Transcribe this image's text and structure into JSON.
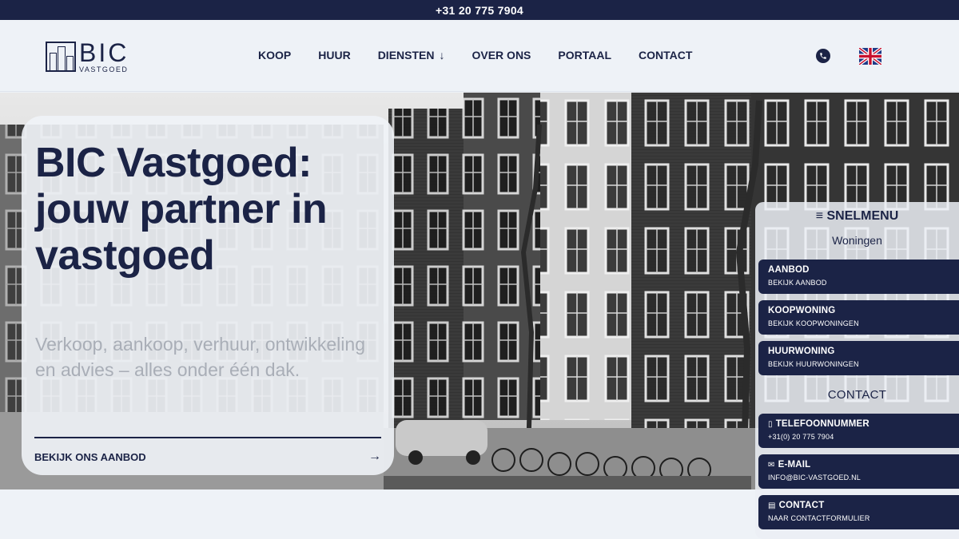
{
  "topbar": {
    "phone": "+31 20 775 7904"
  },
  "logo": {
    "main": "BIC",
    "sub": "VASTGOED"
  },
  "nav": {
    "koop": "KOOP",
    "huur": "HUUR",
    "diensten": "DIENSTEN",
    "over_ons": "OVER ONS",
    "portaal": "PORTAAL",
    "contact": "CONTACT",
    "diensten_arrow": "↓"
  },
  "hero": {
    "title": "BIC Vastgoed: jouw partner in vastgoed",
    "subtitle": "Verkoop, aankoop, verhuur, ontwikkeling en advies – alles onder één dak.",
    "cta": "BEKIJK ONS AANBOD",
    "cta_arrow": "→"
  },
  "snelmenu": {
    "title": "≡ SNELMENU",
    "woningen": "Woningen",
    "contact_heading": "CONTACT",
    "items": [
      {
        "title": "AANBOD",
        "sub": "BEKIJK AANBOD",
        "icon": ""
      },
      {
        "title": "KOOPWONING",
        "sub": "BEKIJK KOOPWONINGEN",
        "icon": ""
      },
      {
        "title": "HUURWONING",
        "sub": "BEKIJK HUURWONINGEN",
        "icon": ""
      },
      {
        "title": "TELEFOONNUMMER",
        "sub": "+31(0) 20 775 7904",
        "icon": "phone-icon"
      },
      {
        "title": "E-MAIL",
        "sub": "INFO@BIC-VASTGOED.NL",
        "icon": "mail-icon"
      },
      {
        "title": "CONTACT",
        "sub": "NAAR CONTACTFORMULIER",
        "icon": "form-icon"
      }
    ]
  },
  "colors": {
    "navy": "#1b2346",
    "background": "#eef2f7",
    "muted_text": "#a9aeb7"
  }
}
